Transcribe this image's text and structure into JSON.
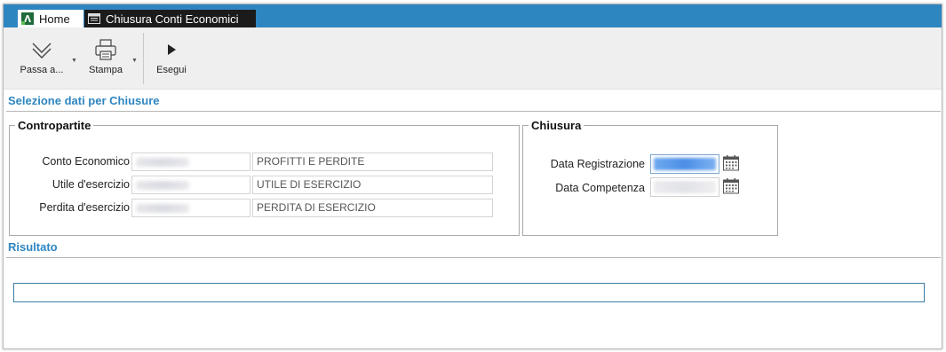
{
  "tabs": [
    {
      "label": "Home"
    },
    {
      "label": "Chiusura Conti Economici"
    }
  ],
  "toolbar": {
    "passa_label": "Passa a...",
    "stampa_label": "Stampa",
    "esegui_label": "Esegui"
  },
  "section_selezione": "Selezione dati per Chiusure",
  "contropartite": {
    "legend": "Contropartite",
    "rows": [
      {
        "label": "Conto Economico",
        "description": "PROFITTI E PERDITE"
      },
      {
        "label": "Utile d'esercizio",
        "description": "UTILE DI ESERCIZIO"
      },
      {
        "label": "Perdita d'esercizio",
        "description": "PERDITA DI ESERCIZIO"
      }
    ]
  },
  "chiusura": {
    "legend": "Chiusura",
    "data_registrazione_label": "Data Registrazione",
    "data_competenza_label": "Data Competenza"
  },
  "section_risultato": "Risultato",
  "colors": {
    "accent": "#2e86c1",
    "tab_active_bg": "#1b1b1b",
    "toolbar_bg": "#efefef"
  }
}
